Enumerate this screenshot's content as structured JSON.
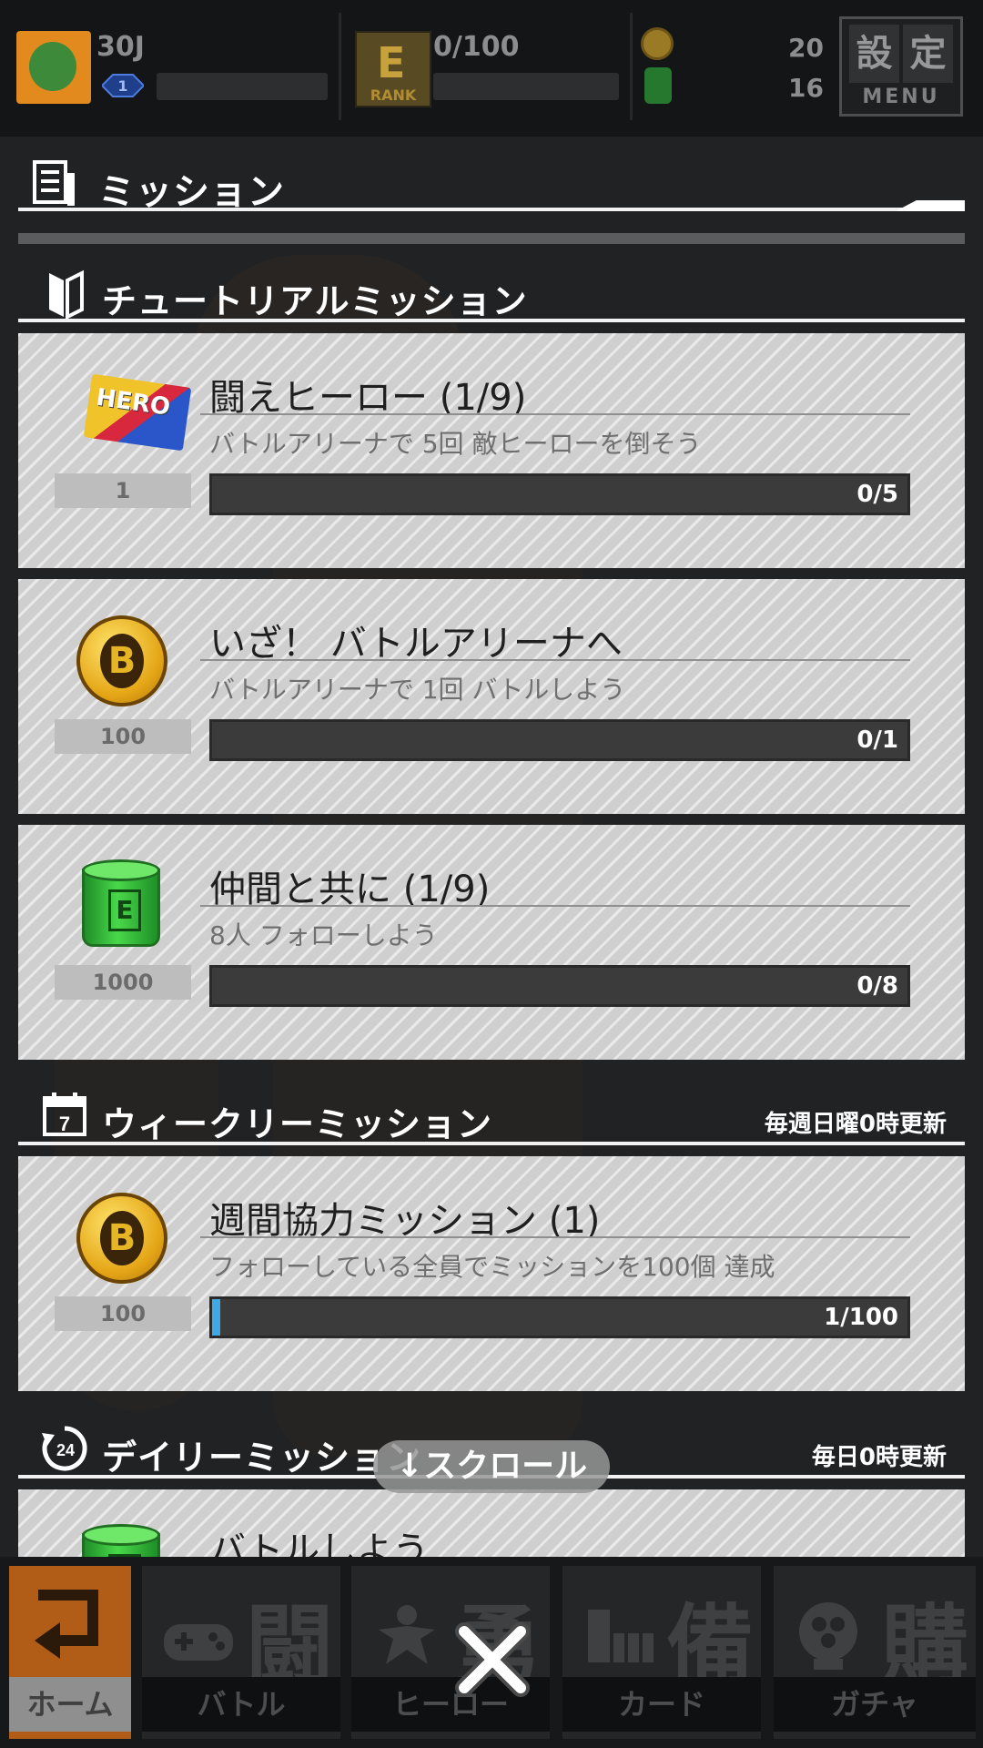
{
  "header": {
    "player_level": "30J",
    "gem_level": "1",
    "rank_badge_letter": "E",
    "rank_badge_label": "RANK",
    "rank_exp": "0/100",
    "coins": "20",
    "energy": "16",
    "menu_kanji": [
      "設",
      "定"
    ],
    "menu_label": "MENU"
  },
  "mission_panel": {
    "title": "ミッション"
  },
  "sections": {
    "tutorial": {
      "title": "チュートリアルミッション"
    },
    "weekly": {
      "title": "ウィークリーミッション",
      "reset_note": "毎週日曜0時更新"
    },
    "daily": {
      "title": "デイリーミッション",
      "reset_note": "毎日0時更新"
    }
  },
  "missions": [
    {
      "title": "闘えヒーロー (1/9)",
      "description": "バトルアリーナで 5回 敵ヒーローを倒そう",
      "reward_amount": "1",
      "reward_icon": "hero-ticket-icon",
      "ticket_text": "HERO",
      "progress_text": "0/5",
      "progress": 0.0
    },
    {
      "title": "いざ！ バトルアリーナへ",
      "description": "バトルアリーナで 1回 バトルしよう",
      "reward_amount": "100",
      "reward_icon": "coin-icon",
      "progress_text": "0/1",
      "progress": 0.0
    },
    {
      "title": "仲間と共に (1/9)",
      "description": "8人 フォローしよう",
      "reward_amount": "1000",
      "reward_icon": "energy-can-icon",
      "progress_text": "0/8",
      "progress": 0.0
    },
    {
      "title": "週間協力ミッション (1)",
      "description": "フォローしている全員でミッションを100個 達成",
      "reward_amount": "100",
      "reward_icon": "coin-icon",
      "progress_text": "1/100",
      "progress": 0.01
    },
    {
      "title": "バトルしよう",
      "reward_icon": "energy-can-icon"
    }
  ],
  "coin_glyph": "B",
  "can_glyph": "E",
  "scroll_hint": "↓スクロール",
  "bottom_nav": [
    {
      "label": "ホーム",
      "kanji": ""
    },
    {
      "label": "バトル",
      "kanji": "闘"
    },
    {
      "label": "ヒーロー",
      "kanji": "勇"
    },
    {
      "label": "カード",
      "kanji": "備"
    },
    {
      "label": "ガチャ",
      "kanji": "購"
    }
  ],
  "colors": {
    "progress_fill": "#3fa9e8",
    "home_active": "#b25d17",
    "panel_bg": "#202224"
  }
}
